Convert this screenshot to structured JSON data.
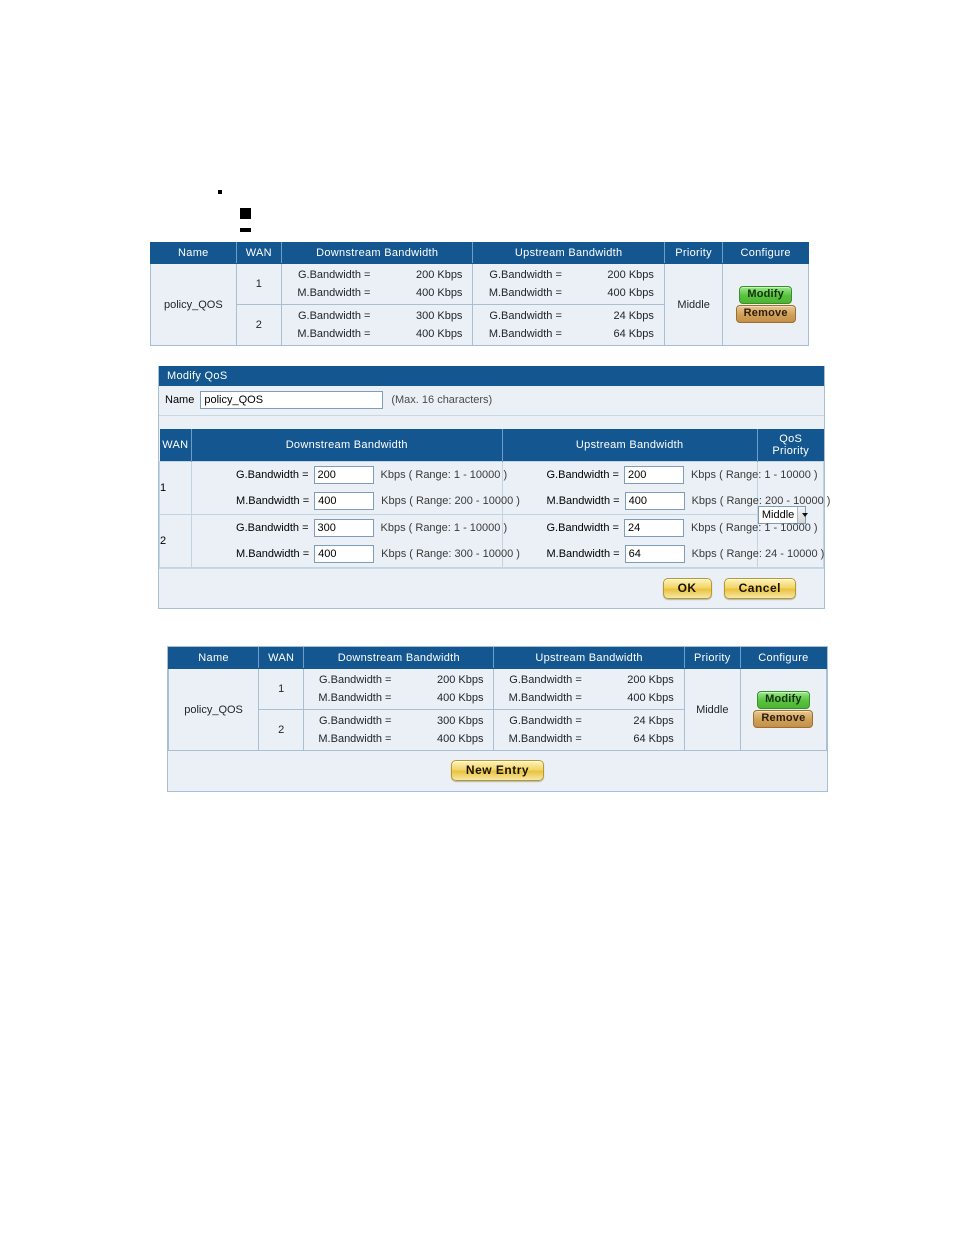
{
  "markers": [
    {
      "name": "bullet-dot-small"
    },
    {
      "name": "bullet-square"
    },
    {
      "name": "bullet-dash"
    }
  ],
  "qos_table": {
    "headers": [
      "Name",
      "WAN",
      "Downstream Bandwidth",
      "Upstream Bandwidth",
      "Priority",
      "Configure"
    ],
    "policy_name": "policy_QOS",
    "priority": "Middle",
    "buttons": {
      "modify": "Modify",
      "remove": "Remove"
    },
    "rows": [
      {
        "wan": "1",
        "down_g_label": "G.Bandwidth =",
        "down_g_value": "200 Kbps",
        "down_m_label": "M.Bandwidth =",
        "down_m_value": "400 Kbps",
        "up_g_label": "G.Bandwidth =",
        "up_g_value": "200 Kbps",
        "up_m_label": "M.Bandwidth =",
        "up_m_value": "400 Kbps"
      },
      {
        "wan": "2",
        "down_g_label": "G.Bandwidth =",
        "down_g_value": "300 Kbps",
        "down_m_label": "M.Bandwidth =",
        "down_m_value": "400 Kbps",
        "up_g_label": "G.Bandwidth =",
        "up_g_value": "24 Kbps",
        "up_m_label": "M.Bandwidth =",
        "up_m_value": "64 Kbps"
      }
    ]
  },
  "modify_form": {
    "title": "Modify QoS",
    "name_label": "Name",
    "name_value": "policy_QOS",
    "name_hint": "(Max. 16 characters)",
    "headers": [
      "WAN",
      "Downstream Bandwidth",
      "Upstream Bandwidth",
      "QoS Priority"
    ],
    "priority_value": "Middle",
    "unit": "Kbps",
    "rows": [
      {
        "wan": "1",
        "down_g_label": "G.Bandwidth =",
        "down_g_value": "200",
        "down_g_range": "( Range: 1 - 10000 )",
        "down_m_label": "M.Bandwidth =",
        "down_m_value": "400",
        "down_m_range": "( Range: 200 - 10000 )",
        "up_g_label": "G.Bandwidth =",
        "up_g_value": "200",
        "up_g_range": "( Range: 1 - 10000 )",
        "up_m_label": "M.Bandwidth =",
        "up_m_value": "400",
        "up_m_range": "( Range: 200 - 10000 )"
      },
      {
        "wan": "2",
        "down_g_label": "G.Bandwidth =",
        "down_g_value": "300",
        "down_g_range": "( Range: 1 - 10000 )",
        "down_m_label": "M.Bandwidth =",
        "down_m_value": "400",
        "down_m_range": "( Range: 300 - 10000 )",
        "up_g_label": "G.Bandwidth =",
        "up_g_value": "24",
        "up_g_range": "( Range: 1 - 10000 )",
        "up_m_label": "M.Bandwidth =",
        "up_m_value": "64",
        "up_m_range": "( Range: 24 - 10000 )"
      }
    ],
    "ok_label": "OK",
    "cancel_label": "Cancel"
  },
  "bottom_table": {
    "headers": [
      "Name",
      "WAN",
      "Downstream Bandwidth",
      "Upstream Bandwidth",
      "Priority",
      "Configure"
    ],
    "policy_name": "policy_QOS",
    "priority": "Middle",
    "buttons": {
      "modify": "Modify",
      "remove": "Remove"
    },
    "new_entry_label": "New Entry",
    "rows": [
      {
        "wan": "1",
        "down_g_label": "G.Bandwidth =",
        "down_g_value": "200 Kbps",
        "down_m_label": "M.Bandwidth =",
        "down_m_value": "400 Kbps",
        "up_g_label": "G.Bandwidth =",
        "up_g_value": "200 Kbps",
        "up_m_label": "M.Bandwidth =",
        "up_m_value": "400 Kbps"
      },
      {
        "wan": "2",
        "down_g_label": "G.Bandwidth =",
        "down_g_value": "300 Kbps",
        "down_m_label": "M.Bandwidth =",
        "down_m_value": "400 Kbps",
        "up_g_label": "G.Bandwidth =",
        "up_g_value": "24 Kbps",
        "up_m_label": "M.Bandwidth =",
        "up_m_value": "64 Kbps"
      }
    ]
  },
  "colors": {
    "header_blue": "#14568f",
    "row_bg": "#eaf0f6",
    "grid": "#a8bfd4",
    "modify_green": "#57c23d",
    "remove_tan": "#cfa059",
    "gold": "#f2d667"
  }
}
